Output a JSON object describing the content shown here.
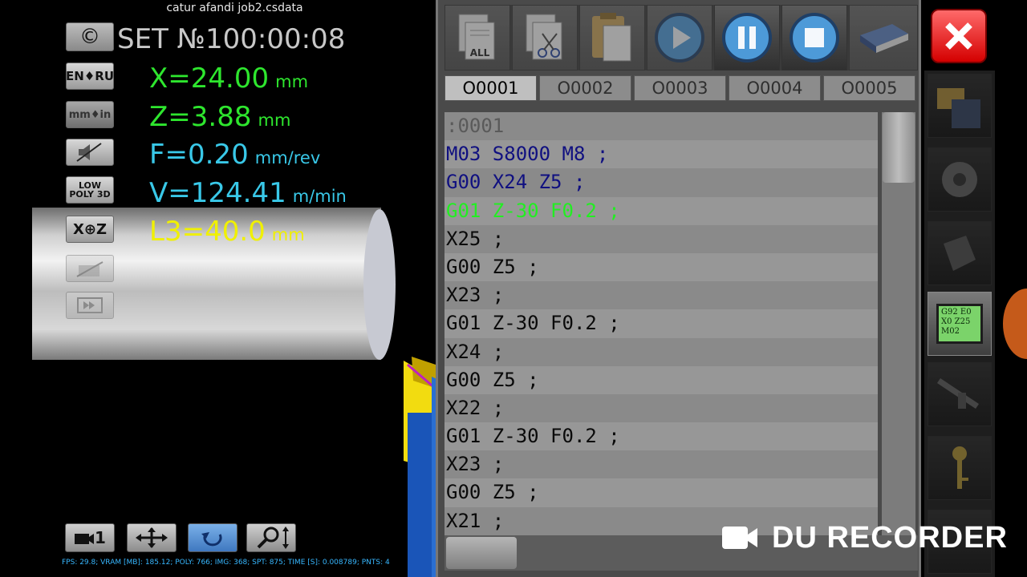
{
  "title": "catur afandi job2.csdata",
  "set_label": "SET №100:00:08",
  "left_buttons": {
    "copyright": "©",
    "lang": "EN♦RU",
    "units": "mm♦in",
    "poly": "LOW POLY 3D",
    "xz": "X⊕Z"
  },
  "readouts": [
    {
      "label": "X=24.00",
      "unit": "mm",
      "color": "#2ee62e"
    },
    {
      "label": "Z=3.88",
      "unit": "mm",
      "color": "#2ee62e"
    },
    {
      "label": "F=0.20",
      "unit": "mm/rev",
      "color": "#39c8e8"
    },
    {
      "label": "V=124.41",
      "unit": "m/min",
      "color": "#39c8e8"
    },
    {
      "label": "L3=40.0",
      "unit": "mm",
      "color": "#f0f000"
    }
  ],
  "bottom_buttons": {
    "camera": "1"
  },
  "stats": "FPS: 29.8; VRAM [MB]: 185.12; POLY: 766; IMG: 368; SPT: 875; TIME [S]: 0.008789; PNTS: 4",
  "toolbar": {
    "select_all_label": "ALL"
  },
  "tabs": [
    "O0001",
    "O0002",
    "O0003",
    "O0004",
    "O0005"
  ],
  "selected_tab": "O0001",
  "code_lines": [
    {
      "text": ":0001",
      "color": "#5a5a5a"
    },
    {
      "text": "M03 S8000 M8 ;",
      "color": "#101080"
    },
    {
      "text": "G00 X24 Z5 ;",
      "color": "#101080"
    },
    {
      "text": "G01 Z-30 F0.2 ;",
      "color": "#22ee22"
    },
    {
      "text": "X25 ;",
      "color": "#0a0a0a"
    },
    {
      "text": "G00 Z5 ;",
      "color": "#0a0a0a"
    },
    {
      "text": "X23 ;",
      "color": "#0a0a0a"
    },
    {
      "text": "G01 Z-30 F0.2 ;",
      "color": "#0a0a0a"
    },
    {
      "text": "X24 ;",
      "color": "#0a0a0a"
    },
    {
      "text": "G00 Z5 ;",
      "color": "#0a0a0a"
    },
    {
      "text": "X22 ;",
      "color": "#0a0a0a"
    },
    {
      "text": "G01 Z-30 F0.2 ;",
      "color": "#0a0a0a"
    },
    {
      "text": "X23 ;",
      "color": "#0a0a0a"
    },
    {
      "text": "G00 Z5 ;",
      "color": "#0a0a0a"
    },
    {
      "text": "X21 ;",
      "color": "#0a0a0a"
    }
  ],
  "screen_icon_text": "G92 E0 X0 Z25 M02",
  "watermark": "DU RECORDER"
}
